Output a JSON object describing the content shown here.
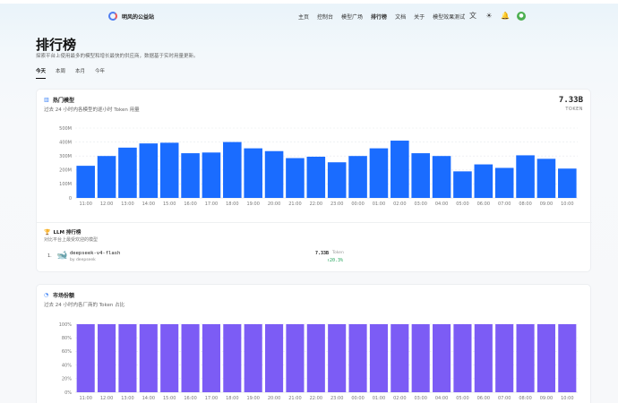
{
  "nav": {
    "brand": "明风的公益站",
    "links": [
      "主页",
      "控制台",
      "模型广场",
      "排行榜",
      "文档",
      "关于",
      "模型效果测试"
    ],
    "active_link": "排行榜"
  },
  "header": {
    "title": "排行榜",
    "subtitle": "探索平台上使用最多的模型和增长最快的供应商，数据基于实时用量更新。",
    "tabs": [
      "今天",
      "本周",
      "本月",
      "今年"
    ],
    "active_tab": "今天"
  },
  "hot_models": {
    "title": "热门模型",
    "subtitle": "过去 24 小时内各模型的逐小时 Token 用量",
    "total": "7.33B",
    "total_unit": "TOKEN"
  },
  "llm_ranking": {
    "title": "LLM 排行榜",
    "subtitle": "对比平台上最受欢迎的模型",
    "rows": [
      {
        "rank": "1.",
        "name": "deepseek-v4-flash",
        "by": "by deepseek",
        "value": "7.33B",
        "unit": "Token",
        "change": "↑20.3%"
      }
    ]
  },
  "market_share": {
    "title": "市场份额",
    "subtitle": "过去 24 小时内各厂商的 Token 占比"
  },
  "chart_data": [
    {
      "type": "bar",
      "categories": [
        "11:00",
        "12:00",
        "13:00",
        "14:00",
        "15:00",
        "16:00",
        "17:00",
        "18:00",
        "19:00",
        "20:00",
        "21:00",
        "22:00",
        "23:00",
        "00:00",
        "01:00",
        "02:00",
        "03:00",
        "04:00",
        "05:00",
        "06:00",
        "07:00",
        "08:00",
        "09:00",
        "10:00"
      ],
      "values": [
        230,
        300,
        360,
        390,
        395,
        320,
        325,
        400,
        355,
        335,
        285,
        295,
        255,
        300,
        355,
        410,
        320,
        300,
        190,
        240,
        215,
        305,
        280,
        210
      ],
      "yticks": [
        "0",
        "100M",
        "200M",
        "300M",
        "400M",
        "500M"
      ],
      "ylim": [
        0,
        500
      ],
      "color": "#1a6cff",
      "grid": true
    },
    {
      "type": "bar",
      "categories": [
        "11:00",
        "12:00",
        "13:00",
        "14:00",
        "15:00",
        "16:00",
        "17:00",
        "18:00",
        "19:00",
        "20:00",
        "21:00",
        "22:00",
        "23:00",
        "00:00",
        "01:00",
        "02:00",
        "03:00",
        "04:00",
        "05:00",
        "06:00",
        "07:00",
        "08:00",
        "09:00",
        "10:00"
      ],
      "values": [
        100,
        100,
        100,
        100,
        100,
        100,
        100,
        100,
        100,
        100,
        100,
        100,
        100,
        100,
        100,
        100,
        100,
        100,
        100,
        100,
        100,
        100,
        100,
        100
      ],
      "yticks": [
        "0%",
        "20%",
        "40%",
        "60%",
        "80%",
        "100%"
      ],
      "ylim": [
        0,
        100
      ],
      "color": "#7c5cf5",
      "grid": true
    }
  ]
}
